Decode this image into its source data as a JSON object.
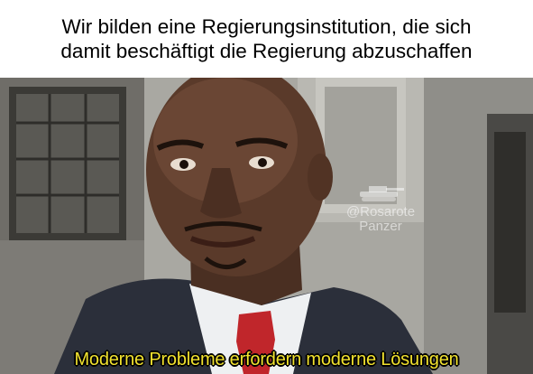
{
  "meme": {
    "top_caption": {
      "line1": "Wir bilden eine Regierungsinstitution, die sich",
      "line2": "damit beschäftigt die Regierung abzuschaffen"
    },
    "bottom_caption": "Moderne Probleme erfordern moderne Lösungen",
    "watermark": {
      "handle": "@Rosarote",
      "name": "Panzer"
    },
    "colors": {
      "caption_yellow": "#f2e22e",
      "background": "#ffffff"
    }
  }
}
